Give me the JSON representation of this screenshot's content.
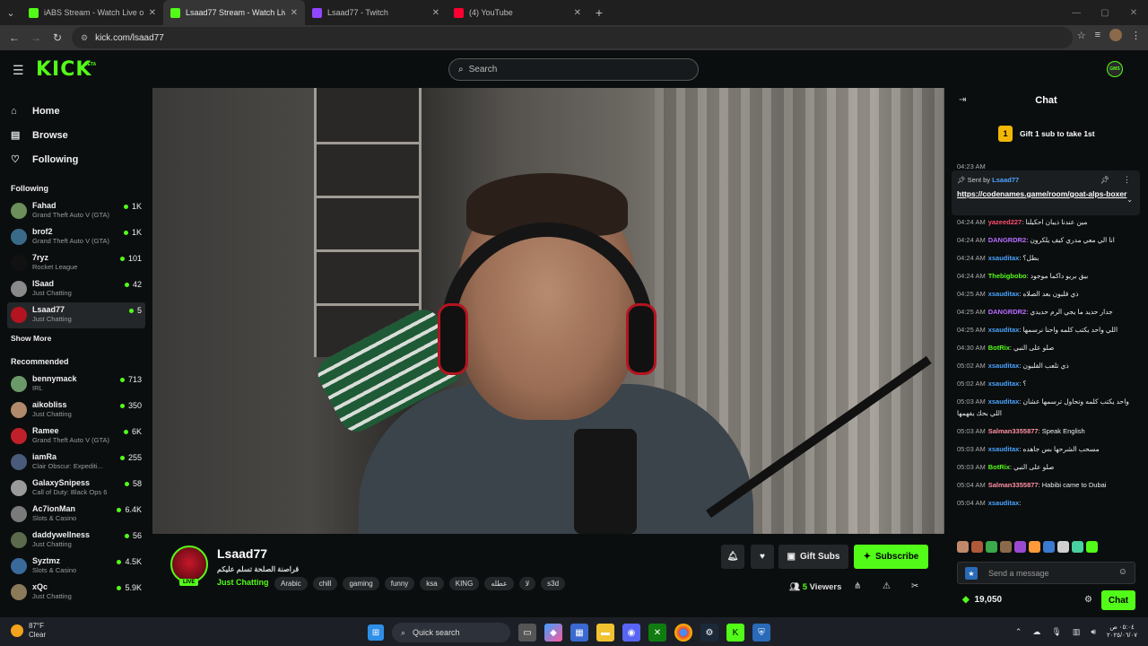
{
  "browser": {
    "tabs": [
      {
        "label": "iABS Stream - Watch Live on Kick",
        "color": "#53fc18",
        "active": false
      },
      {
        "label": "Lsaad77 Stream - Watch Live on Kick",
        "color": "#53fc18",
        "active": true
      },
      {
        "label": "Lsaad77 - Twitch",
        "color": "#9146ff",
        "active": false
      },
      {
        "label": "(4) YouTube",
        "color": "#ff0033",
        "active": false
      }
    ],
    "url": "kick.com/lsaad77"
  },
  "header": {
    "logo": "KICK",
    "beta": "BETA",
    "search_placeholder": "Search",
    "user_avatar_text": "GMS"
  },
  "sidebar": {
    "nav": [
      {
        "label": "Home",
        "icon": "home-icon",
        "glyph": "⌂"
      },
      {
        "label": "Browse",
        "icon": "browse-icon",
        "glyph": "▤"
      },
      {
        "label": "Following",
        "icon": "heart-icon",
        "glyph": "♡"
      }
    ],
    "following_title": "Following",
    "following": [
      {
        "name": "Fahad",
        "game": "Grand Theft Auto V (GTA)",
        "viewers": "1K",
        "color": "#6b8e5a"
      },
      {
        "name": "brof2",
        "game": "Grand Theft Auto V (GTA)",
        "viewers": "1K",
        "color": "#3a6a8a"
      },
      {
        "name": "7ryz",
        "game": "Rocket League",
        "viewers": "101",
        "color": "#111111"
      },
      {
        "name": "lSaad",
        "game": "Just Chatting",
        "viewers": "42",
        "color": "#8a8a8a"
      },
      {
        "name": "Lsaad77",
        "game": "Just Chatting",
        "viewers": "5",
        "color": "#b3141f"
      }
    ],
    "show_more": "Show More",
    "recommended_title": "Recommended",
    "recommended": [
      {
        "name": "bennymack",
        "game": "IRL",
        "viewers": "713",
        "color": "#6a9a6a"
      },
      {
        "name": "aikobliss",
        "game": "Just Chatting",
        "viewers": "350",
        "color": "#b08a6a"
      },
      {
        "name": "Ramee",
        "game": "Grand Theft Auto V (GTA)",
        "viewers": "6K",
        "color": "#c0202a"
      },
      {
        "name": "iamRa",
        "game": "Clair Obscur: Expediti...",
        "viewers": "255",
        "color": "#4a5a7a"
      },
      {
        "name": "GalaxySnipess",
        "game": "Call of Duty: Black Ops 6",
        "viewers": "58",
        "color": "#9a9a9a"
      },
      {
        "name": "Ac7ionMan",
        "game": "Slots & Casino",
        "viewers": "6.4K",
        "color": "#7a7a7a"
      },
      {
        "name": "daddywellness",
        "game": "Just Chatting",
        "viewers": "56",
        "color": "#5a6a4a"
      },
      {
        "name": "Syztmz",
        "game": "Slots & Casino",
        "viewers": "4.5K",
        "color": "#3a6a9a"
      },
      {
        "name": "xQc",
        "game": "Just Chatting",
        "viewers": "5.9K",
        "color": "#8a7a5a"
      }
    ]
  },
  "stream": {
    "name": "Lsaad77",
    "title": "قراصنة الصلحة تسلم عليكم",
    "live": "LIVE",
    "category": "Just Chatting",
    "tags": [
      "Arabic",
      "chill",
      "gaming",
      "funny",
      "ksa",
      "KING",
      "عطله",
      "لا",
      "s3d"
    ],
    "gift_subs": "Gift Subs",
    "subscribe": "Subscribe",
    "viewers_count": "5",
    "viewers_label": "Viewers"
  },
  "chat": {
    "title": "Chat",
    "gift_banner": "Gift 1 sub to take 1st",
    "gift_number": "1",
    "pinned": {
      "top_time": "04:23 AM",
      "sent_by": "Sent by",
      "sender": "Lsaad77",
      "link": "https://codenames.game/room/goat-alps-boxer"
    },
    "messages": [
      {
        "time": "04:24 AM",
        "user": "yazeed227",
        "color": "#ff4d6d",
        "text": "مين عندنا ذيبان احكيلنا"
      },
      {
        "time": "04:24 AM",
        "user": "DANGRDR2",
        "color": "#b86bff",
        "text": "انا الي معي مدري كيف يلكرون"
      },
      {
        "time": "04:24 AM",
        "user": "xsauditax",
        "color": "#4aa3ff",
        "text": "بطل؟"
      },
      {
        "time": "04:24 AM",
        "user": "Thebigbobo",
        "color": "#53fc18",
        "text": "بيق بريو داكما موجود"
      },
      {
        "time": "04:25 AM",
        "user": "xsauditax",
        "color": "#4aa3ff",
        "text": "ذي قلبون بعد الصلاه"
      },
      {
        "time": "04:25 AM",
        "user": "DANGRDR2",
        "color": "#b86bff",
        "text": "جدار حديد ما يجي الرم حديدي"
      },
      {
        "time": "04:25 AM",
        "user": "xsauditax",
        "color": "#4aa3ff",
        "text": "اللي واحد يكتب كلمه واحنا نرسمها"
      },
      {
        "time": "04:30 AM",
        "user": "BotRix",
        "color": "#53fc18",
        "text": "صلو على النبي"
      },
      {
        "time": "05:02 AM",
        "user": "xsauditax",
        "color": "#4aa3ff",
        "text": "ذي تلعب القلبون"
      },
      {
        "time": "05:02 AM",
        "user": "xsauditax",
        "color": "#4aa3ff",
        "text": "؟"
      },
      {
        "time": "05:03 AM",
        "user": "xsauditax",
        "color": "#4aa3ff",
        "text": "واحد يكتب كلمه وتحاول ترسمها عشان اللي بحك يفهمها"
      },
      {
        "time": "05:03 AM",
        "user": "Salman3355877",
        "color": "#ff8fa3",
        "text": "Speak English"
      },
      {
        "time": "05:03 AM",
        "user": "xsauditax",
        "color": "#4aa3ff",
        "text": "مسحب الشرحها بس جاهده"
      },
      {
        "time": "05:03 AM",
        "user": "BotRix",
        "color": "#53fc18",
        "text": "صلو على النبي"
      },
      {
        "time": "05:04 AM",
        "user": "Salman3355877",
        "color": "#ff8fa3",
        "text": "Habibi came to Dubai"
      },
      {
        "time": "05:04 AM",
        "user": "xsauditax",
        "color": "#4aa3ff",
        "text": ""
      }
    ],
    "emote_colors": [
      "#c08a6a",
      "#b05a3a",
      "#3aaa4a",
      "#8a6a4a",
      "#9a4ad0",
      "#ff9a3a",
      "#3a7ad0",
      "#d0d0d0",
      "#4ad0a0",
      "#53fc18"
    ],
    "send_placeholder": "Send a message",
    "kicks": "19,050",
    "chat_button": "Chat"
  },
  "taskbar": {
    "temp": "87°F",
    "condition": "Clear",
    "quick_search": "Quick search",
    "time": "٠٥:٠٤ ص",
    "date": "٢٠٢٥/٠٦/٠٧"
  }
}
